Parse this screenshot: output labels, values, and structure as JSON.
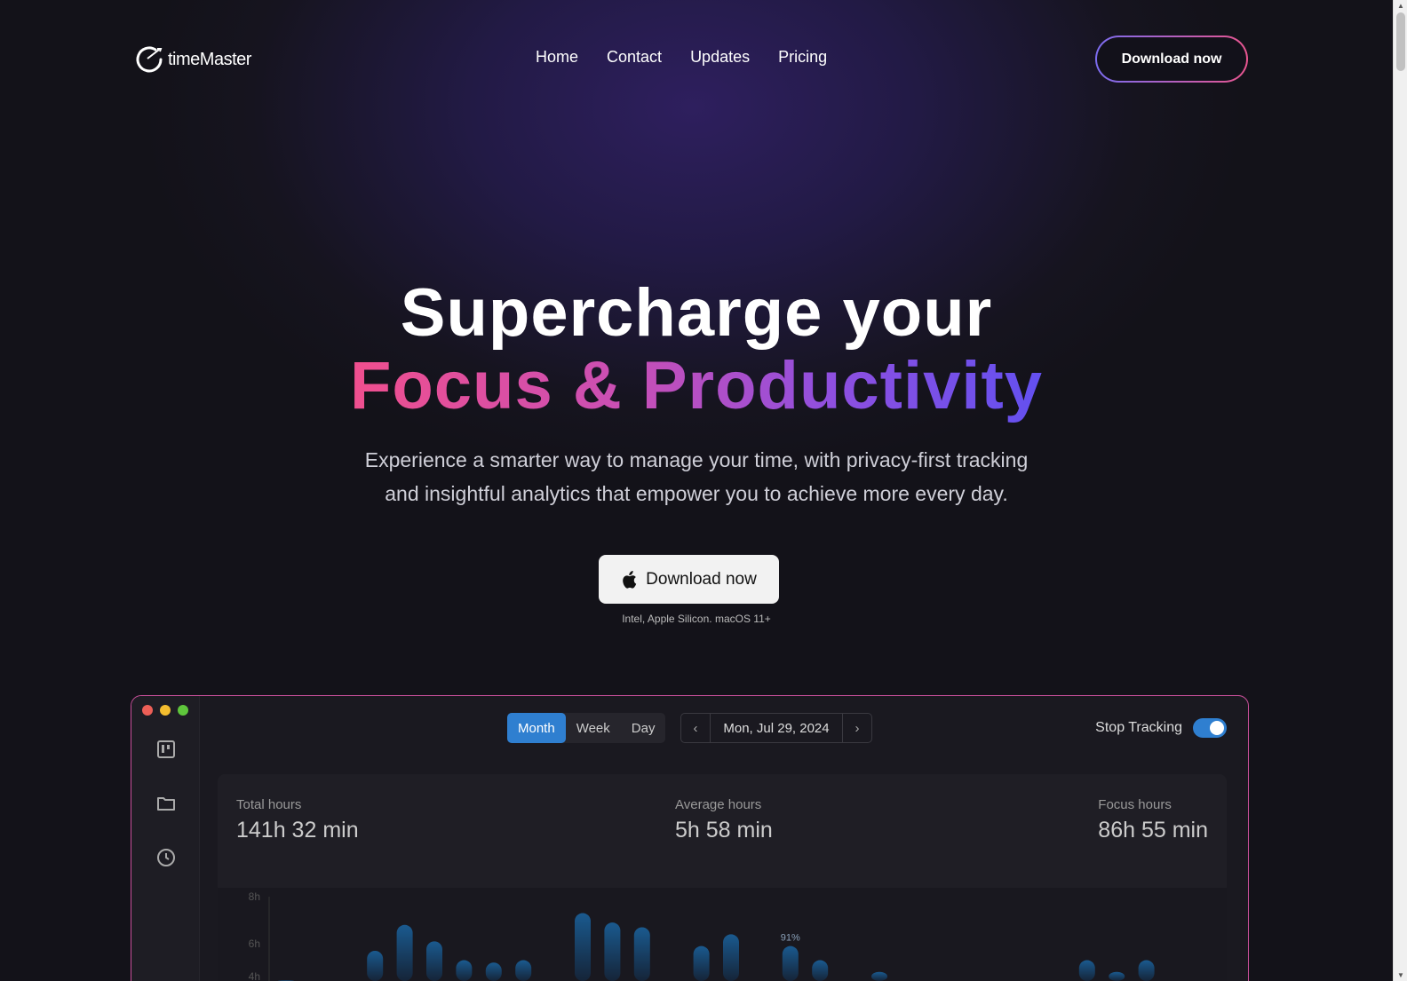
{
  "nav": {
    "brand": "timeMaster",
    "links": [
      "Home",
      "Contact",
      "Updates",
      "Pricing"
    ],
    "download": "Download now"
  },
  "hero": {
    "line1": "Supercharge your",
    "line2": "Focus & Productivity",
    "sub1": "Experience a smarter way to manage your time, with privacy-first tracking",
    "sub2": "and insightful analytics that empower you to achieve more every day.",
    "cta": "Download now",
    "cta_icon": "apple-icon",
    "note": "Intel, Apple Silicon. macOS 11+"
  },
  "app": {
    "tabs": [
      "Month",
      "Week",
      "Day"
    ],
    "active_tab": "Month",
    "date": "Mon, Jul 29, 2024",
    "tracking_label": "Stop Tracking",
    "tracking_on": true,
    "sidebar_icons": [
      "board-icon",
      "folder-icon",
      "clock-icon"
    ],
    "stats": [
      {
        "label": "Total hours",
        "value": "141h 32 min"
      },
      {
        "label": "Average hours",
        "value": "5h 58 min"
      },
      {
        "label": "Focus hours",
        "value": "86h 55 min"
      }
    ]
  },
  "chart_data": {
    "type": "bar",
    "yticks": [
      "8h",
      "6h",
      "4h"
    ],
    "ylim": [
      0,
      8
    ],
    "bar_color": "#1a5a8f",
    "annotation": {
      "index": 17,
      "text": "91%"
    },
    "values": [
      4.45,
      0,
      0,
      5.7,
      6.8,
      6.1,
      5.3,
      5.2,
      5.3,
      0,
      7.3,
      6.9,
      6.7,
      4.2,
      5.9,
      6.4,
      0,
      5.9,
      5.3,
      4.4,
      4.8,
      0,
      4.4,
      0,
      0,
      0,
      4.4,
      5.3,
      4.8,
      5.3
    ]
  }
}
